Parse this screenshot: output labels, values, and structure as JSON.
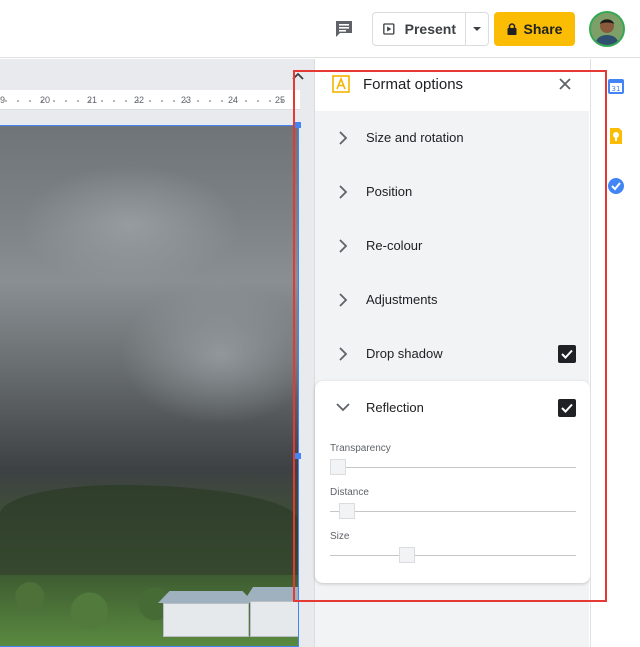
{
  "toolbar": {
    "present_label": "Present",
    "share_label": "Share"
  },
  "ruler": {
    "ticks": [
      "9",
      "20",
      "21",
      "22",
      "23",
      "24",
      "25"
    ]
  },
  "panel": {
    "title": "Format options",
    "sections": [
      {
        "label": "Size and rotation",
        "checked": null
      },
      {
        "label": "Position",
        "checked": null
      },
      {
        "label": "Re-colour",
        "checked": null
      },
      {
        "label": "Adjustments",
        "checked": null
      },
      {
        "label": "Drop shadow",
        "checked": true
      }
    ],
    "reflection": {
      "label": "Reflection",
      "checked": true,
      "sliders": [
        {
          "label": "Transparency",
          "value": 0.0
        },
        {
          "label": "Distance",
          "value": 0.04
        },
        {
          "label": "Size",
          "value": 0.3
        }
      ]
    }
  },
  "colors": {
    "accent": "#4285f4",
    "share": "#fbbc04",
    "highlight": "#e53935"
  }
}
